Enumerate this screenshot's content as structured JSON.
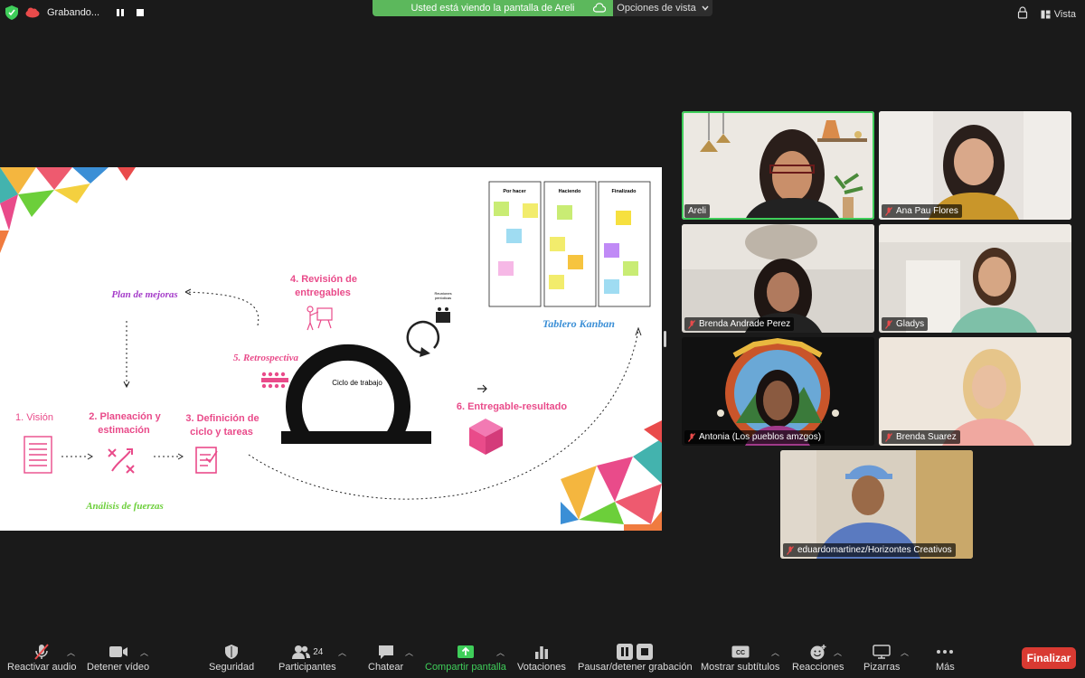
{
  "top_bar": {
    "recording_label": "Grabando...",
    "share_banner": "Usted está viendo la pantalla de Areli",
    "view_options": "Opciones de vista",
    "view_label": "Vista"
  },
  "slide": {
    "kanban": {
      "columns": [
        "Por hacer",
        "Haciendo",
        "Finalizado"
      ],
      "title": "Tablero Kanban"
    },
    "steps": {
      "plan": "Plan de mejoras",
      "review_1": "4. Revisión de",
      "review_2": "entregables",
      "meetings_1": "Reuniones",
      "meetings_2": "periódicas",
      "retro": "5. Retrospectiva",
      "cycle": "Ciclo de trabajo",
      "vision": "1. Visión",
      "planning_1": "2. Planeación y",
      "planning_2": "estimación",
      "definition_1": "3. Definición de",
      "definition_2": "ciclo y tareas",
      "deliverable": "6. Entregable-resultado",
      "forces": "Análisis de fuerzas"
    }
  },
  "participants": [
    {
      "name": "Areli",
      "muted": false
    },
    {
      "name": "Ana Pau Flores",
      "muted": true
    },
    {
      "name": "Brenda Andrade Perez",
      "muted": true
    },
    {
      "name": "Gladys",
      "muted": true
    },
    {
      "name": "Antonia (Los pueblos amzgos)",
      "muted": true
    },
    {
      "name": "Brenda Suarez",
      "muted": true
    },
    {
      "name": "eduardomartinez/Horizontes Creativos",
      "muted": true
    }
  ],
  "toolbar": {
    "unmute": "Reactivar audio",
    "stop_video": "Detener vídeo",
    "security": "Seguridad",
    "participants": "Participantes",
    "participants_count": "24",
    "chat": "Chatear",
    "share": "Compartir pantalla",
    "polls": "Votaciones",
    "pause_record": "Pausar/detener grabación",
    "subtitles": "Mostrar subtítulos",
    "reactions": "Reacciones",
    "whiteboards": "Pizarras",
    "more": "Más",
    "end": "Finalizar"
  },
  "colors": {
    "accent_green": "#3fce5a",
    "banner_green": "#5cb85c",
    "end_red": "#d93a32",
    "slide_pink": "#e94b8a",
    "slide_purple": "#a43ac9",
    "slide_blue": "#3b8fd6",
    "slide_green": "#6ccf3a"
  }
}
